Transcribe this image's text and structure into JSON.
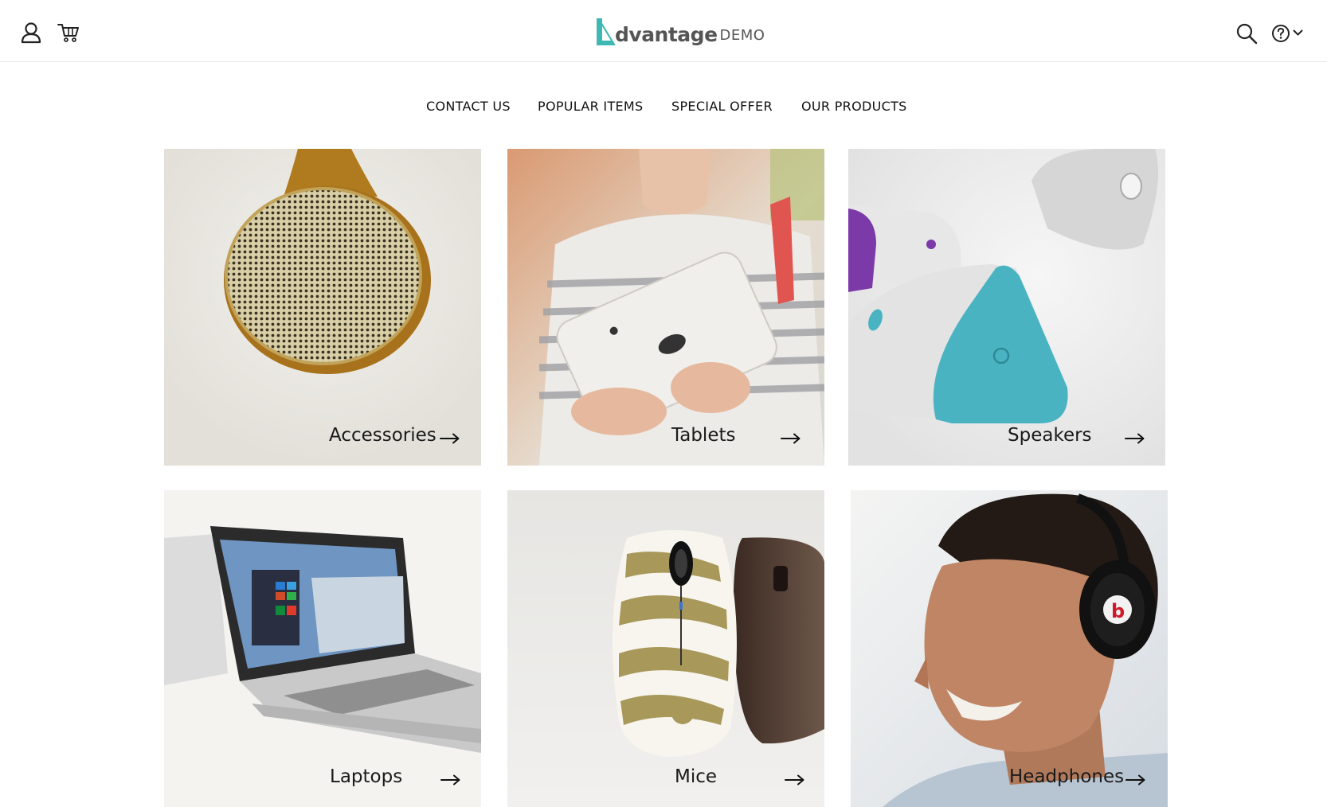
{
  "header": {
    "logo": {
      "name": "dvantage",
      "suffix": "DEMO"
    },
    "icons": {
      "user": "user-icon",
      "cart": "cart-icon",
      "search": "search-icon",
      "help": "help-icon",
      "help_menu": "chevron-down-icon"
    }
  },
  "nav": {
    "items": [
      {
        "label": "CONTACT US"
      },
      {
        "label": "POPULAR ITEMS"
      },
      {
        "label": "SPECIAL OFFER"
      },
      {
        "label": "OUR PRODUCTS"
      }
    ]
  },
  "categories": [
    {
      "label": "Accessories"
    },
    {
      "label": "Tablets"
    },
    {
      "label": "Speakers"
    },
    {
      "label": "Laptops"
    },
    {
      "label": "Mice"
    },
    {
      "label": "Headphones"
    }
  ],
  "colors": {
    "brand_teal": "#3fb8b4",
    "text_dark": "#1a1a1a",
    "logo_grey": "#555555",
    "header_border": "#e6e6e6"
  }
}
